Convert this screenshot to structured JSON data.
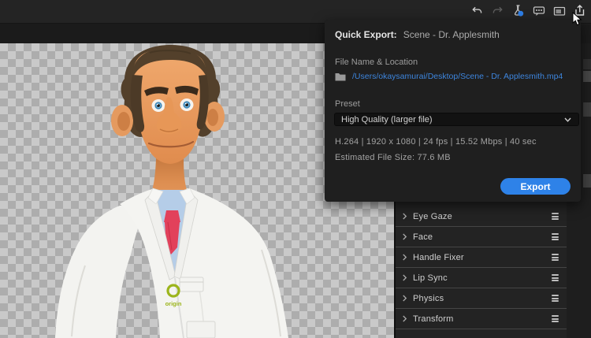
{
  "toolbar": {
    "icons": [
      "undo",
      "redo",
      "lab-flask",
      "comments",
      "panels",
      "quick-export"
    ]
  },
  "quick_export": {
    "title_label": "Quick Export:",
    "scene_name": "Scene - Dr. Applesmith",
    "file_section_label": "File Name & Location",
    "file_path": "/Users/okaysamurai/Desktop/Scene - Dr. Applesmith.mp4",
    "preset_label": "Preset",
    "preset_value": "High Quality (larger file)",
    "specs": "H.264 | 1920 x 1080 | 24 fps | 15.52 Mbps | 40 sec",
    "estimated_file_size": "Estimated File Size: 77.6 MB",
    "export_button_label": "Export"
  },
  "properties_panel": {
    "items": [
      {
        "label": "Eye Gaze"
      },
      {
        "label": "Face"
      },
      {
        "label": "Handle Fixer"
      },
      {
        "label": "Lip Sync"
      },
      {
        "label": "Physics"
      },
      {
        "label": "Transform"
      }
    ]
  },
  "character": {
    "badge_text": "origin"
  },
  "colors": {
    "accent_blue": "#2e82e8",
    "link_blue": "#3d85dd",
    "logo_green": "#9cb51c",
    "flask_badge_blue": "#2e7fe8",
    "tie_red": "#e2415b"
  }
}
